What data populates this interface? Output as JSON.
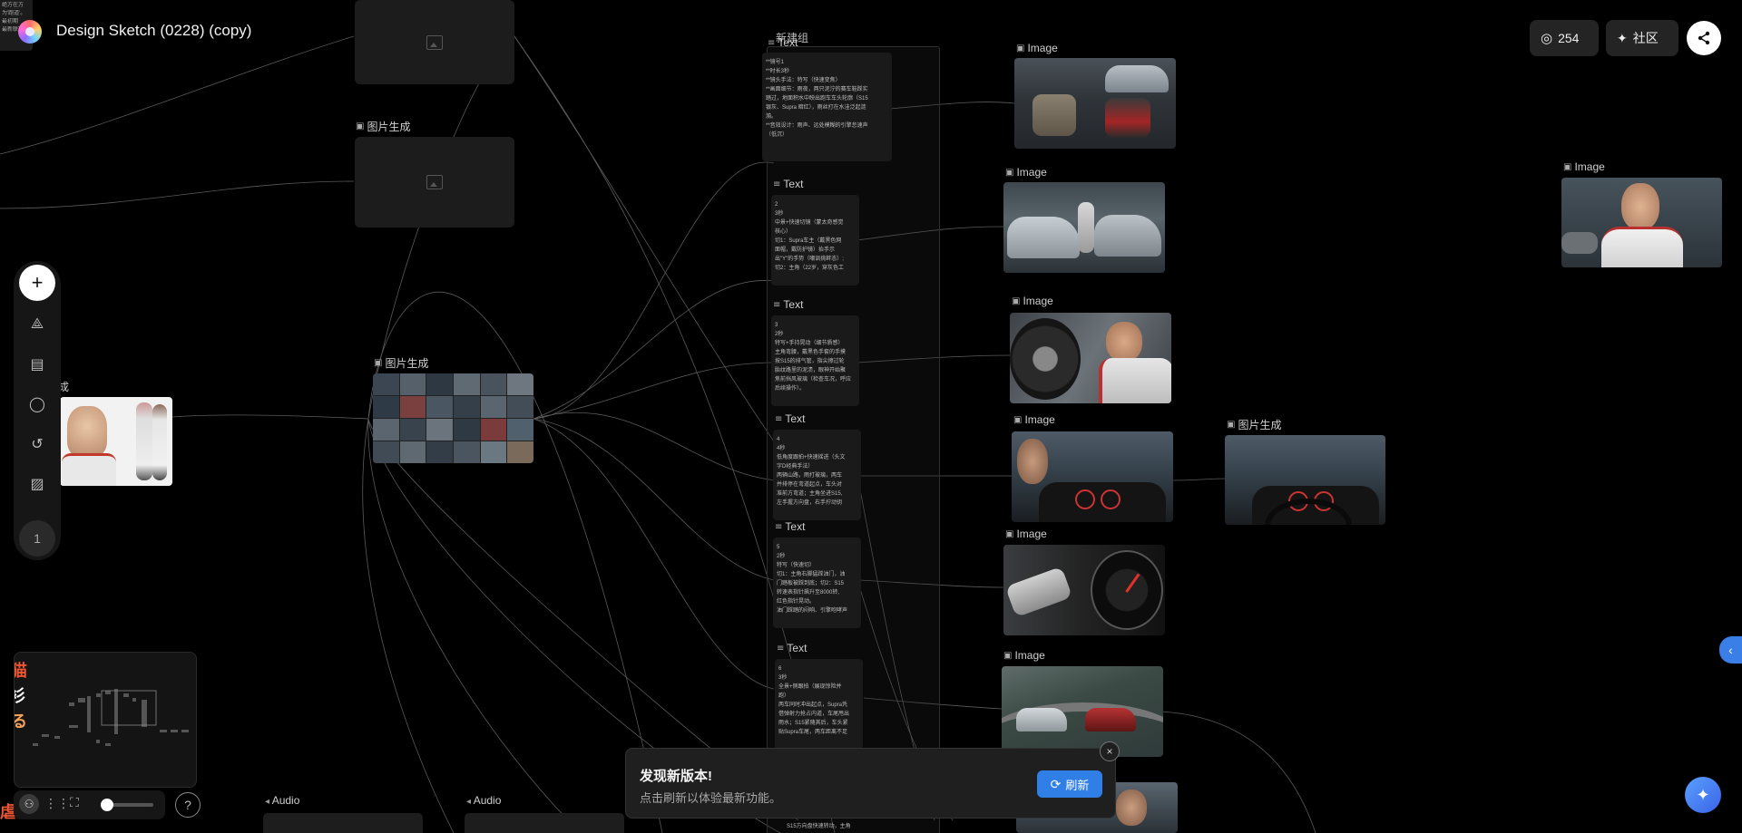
{
  "header": {
    "title": "Design Sketch (0228) (copy)",
    "credits": "254",
    "community_label": "社区"
  },
  "top_left_fragment": {
    "lines": [
      "绝方在方",
      "为'跑道'。",
      "最初期",
      "最新联赛"
    ]
  },
  "nodes": {
    "image_gen_label": "图片生成",
    "image_label": "Image",
    "text_label": "Text",
    "group_label": "新建组",
    "audio_label": "Audio",
    "partial_gen_label": "成"
  },
  "text_nodes": [
    {
      "lines": [
        "**镜号1",
        "**时长3秒",
        "**镜头手法：特写（快速变焦）",
        "**画面细节：雨夜，两只泥泞的赛车鞋踩实",
        "踏过，地面积水中映出跑车车头轮廓（S15",
        "银灰、Supra 暗红），雨丝打在水洼泛起涟",
        "漪。",
        "**音效设计：雨声、远处模糊的引擎怠速声",
        "（低沉）"
      ]
    },
    {
      "lines": [
        "2",
        "3秒",
        "中景+快速切镜（蒙太奇感觉",
        "核心）",
        "切1：Supra车主（戴黑色网",
        "面帽，戴防护镜）抬手示",
        "出\"Y\"的手势（嘲讽挑衅态）;",
        "切2：主角（22岁，穿灰色工"
      ]
    },
    {
      "lines": [
        "3",
        "2秒",
        "特写+手持晃动（细节质感）",
        "主角弯腰，戴黑色手套的手摸",
        "按S15的排气管，指尖擦过轮",
        "胎纹路里的泥渍，眼神开始聚",
        "焦前挡风玻璃（检查车况，呼应",
        "后续操作）。"
      ]
    },
    {
      "lines": [
        "4",
        "4秒",
        "低角度跟拍+快速摇进（头文",
        "字D经典手法）",
        "两辆山路，雨打玻璃，两车",
        "并排停在弯道起点，车头对",
        "准前方弯道；主角坐进S15,",
        "左手握方向盘，右手拧动钥"
      ]
    },
    {
      "lines": [
        "5",
        "2秒",
        "特写（快速切）",
        "切1：主角右脚猛踩油门，油",
        "门踏板被踩到底；切2：S15",
        "转速表指针飙升至8000转,",
        "红色指针晃动。",
        "油门踩踏的闷响、引擎咆哮声"
      ]
    },
    {
      "lines": [
        "6",
        "3秒",
        "全景+侧跟拍（展现惊险并",
        "跑）",
        "两车同时冲出起点，Supra凭",
        "借弹射力抢占内道，车尾甩出",
        "雨水；S15紧随其后，车头紧",
        "贴Supra车尾，两车距离不足"
      ]
    }
  ],
  "bottom_text_fragment": "S15方向盘快速转动，主角",
  "toast": {
    "title": "发现新版本!",
    "description": "点击刷新以体验最新功能。",
    "refresh_label": "刷新",
    "close_label": "×"
  },
  "toolbar": {
    "add_label": "+",
    "page_number": "1"
  },
  "minimap_fragment_glyphs": [
    "猫",
    "衫",
    "る",
    "虐"
  ],
  "colors": {
    "background": "#000000",
    "accent": "#2f7fe6",
    "node_bg": "#1c1c1c"
  }
}
